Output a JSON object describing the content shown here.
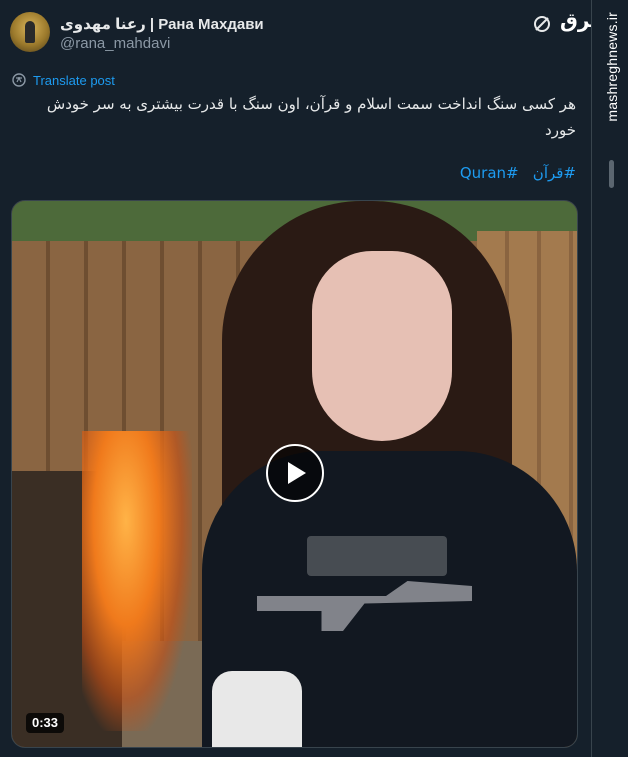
{
  "author": {
    "display_name": "رعنا مهدوی | Рана Махдави",
    "handle": "@rana_mahdavi"
  },
  "icons": {
    "grok": "grok-icon",
    "translate": "translate-icon",
    "play": "play-icon",
    "watermark_logo": "mashregh-logo"
  },
  "watermark": {
    "logo_text": "مشرق",
    "site": "mashreghnews.ir"
  },
  "post": {
    "translate_label": "Translate post",
    "text": "هر کسی سنگ انداخت سمت اسلام و قرآن، اون سنگ با قدرت بیشتری به سر خودش خورد",
    "hashtags": [
      "#قرآن",
      "#Quran"
    ]
  },
  "media": {
    "duration": "0:33"
  },
  "colors": {
    "background": "#15202b",
    "link": "#1d9bf0",
    "text": "#e7e9ea",
    "secondary_text": "#8b98a5"
  }
}
